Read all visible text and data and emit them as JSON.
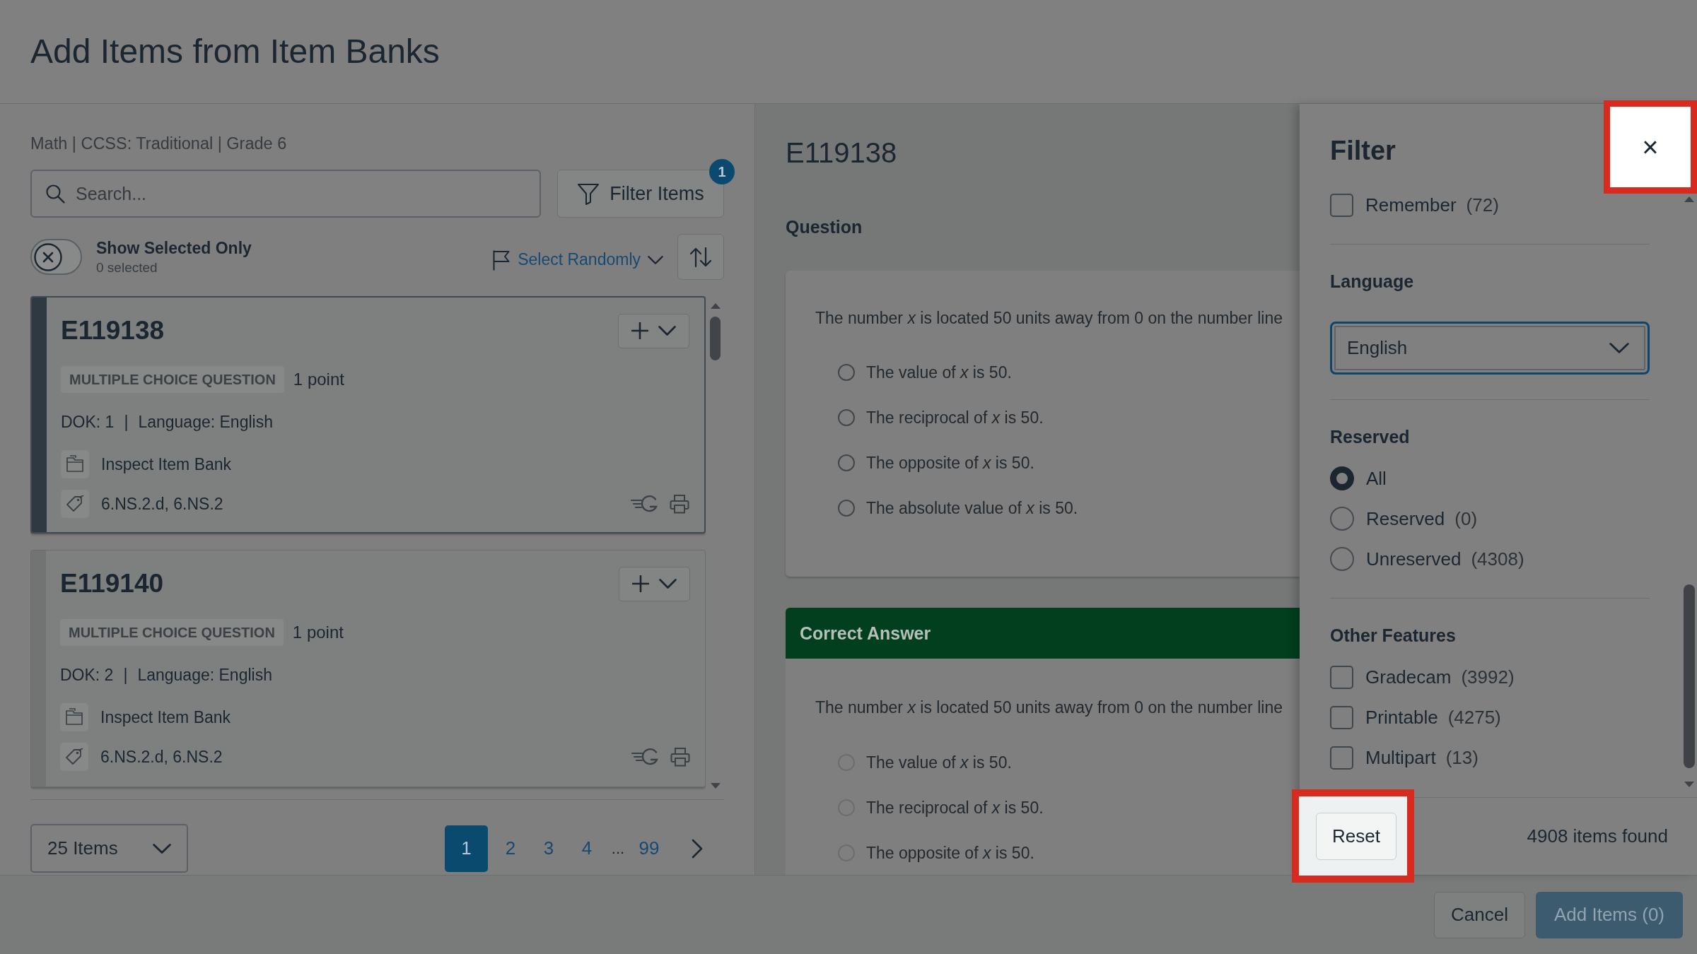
{
  "dialog": {
    "title": "Add Items from Item Banks"
  },
  "item_list": {
    "breadcrumb": "Math | CCSS: Traditional | Grade 6",
    "search": {
      "placeholder": "Search..."
    },
    "filter_button": {
      "label": "Filter Items",
      "badge": "1"
    },
    "show_selected_toggle": {
      "on": false,
      "label": "Show Selected Only",
      "count": "0 selected"
    },
    "select_randomly": {
      "label": "Select Randomly"
    },
    "items": [
      {
        "id": "E119138",
        "selected": true,
        "type": "MULTIPLE CHOICE QUESTION",
        "points": "1 point",
        "dok": "DOK: 1",
        "separator": "|",
        "language": "Language: English",
        "bank_link": "Inspect Item Bank",
        "standards": "6.NS.2.d, 6.NS.2"
      },
      {
        "id": "E119140",
        "selected": false,
        "type": "MULTIPLE CHOICE QUESTION",
        "points": "1 point",
        "dok": "DOK: 2",
        "separator": "|",
        "language": "Language: English",
        "bank_link": "Inspect Item Bank",
        "standards": "6.NS.2.d, 6.NS.2"
      }
    ],
    "page_size": {
      "value": "25 Items"
    },
    "pages": [
      {
        "kind": "page",
        "label": "1",
        "selected": true
      },
      {
        "kind": "page",
        "label": "2",
        "selected": false
      },
      {
        "kind": "page",
        "label": "3",
        "selected": false
      },
      {
        "kind": "page",
        "label": "4",
        "selected": false
      },
      {
        "kind": "ellipsis",
        "label": "...",
        "selected": false
      },
      {
        "kind": "page",
        "label": "99",
        "selected": false
      }
    ]
  },
  "preview": {
    "id": "E119138",
    "question": {
      "heading": "Question",
      "stem": "The number *x* is located 50 units away from 0 on the number line",
      "options": [
        {
          "text": "The value of *x* is 50.",
          "selected": false
        },
        {
          "text": "The reciprocal of *x* is 50.",
          "selected": false
        },
        {
          "text": "The opposite of *x* is 50.",
          "selected": false
        },
        {
          "text": "The absolute value of *x* is 50.",
          "selected": false
        }
      ]
    },
    "correct_answer": {
      "heading": "Correct Answer",
      "stem": "The number *x* is located 50 units away from 0 on the number line",
      "options": [
        {
          "text": "The value of *x* is 50.",
          "selected": false
        },
        {
          "text": "The reciprocal of *x* is 50.",
          "selected": false
        },
        {
          "text": "The opposite of *x* is 50.",
          "selected": false
        }
      ]
    }
  },
  "filter_panel": {
    "title": "Filter",
    "close_button": {
      "label": "×",
      "highlighted": true
    },
    "sections": [
      {
        "kind": "checkbox",
        "options": [
          {
            "label": "Remember",
            "count": "(72)",
            "checked": false
          }
        ]
      },
      {
        "kind": "select",
        "heading": "Language",
        "value": "English"
      },
      {
        "kind": "radio",
        "heading": "Reserved",
        "options": [
          {
            "label": "All",
            "selected": true
          },
          {
            "label": "Reserved",
            "count": "(0)",
            "selected": false
          },
          {
            "label": "Unreserved",
            "count": "(4308)",
            "selected": false
          }
        ]
      },
      {
        "kind": "checkbox",
        "heading": "Other Features",
        "options": [
          {
            "label": "Gradecam",
            "count": "(3992)",
            "checked": false
          },
          {
            "label": "Printable",
            "count": "(4275)",
            "checked": false
          },
          {
            "label": "Multipart",
            "count": "(13)",
            "checked": false
          }
        ]
      }
    ],
    "reset_button": {
      "label": "Reset",
      "highlighted": true
    },
    "result_count": "4908 items found"
  },
  "footer": {
    "buttons": [
      {
        "kind": "secondary",
        "label": "Cancel",
        "disabled": false
      },
      {
        "kind": "primary",
        "label": "Add Items (0)",
        "disabled": true
      }
    ]
  }
}
